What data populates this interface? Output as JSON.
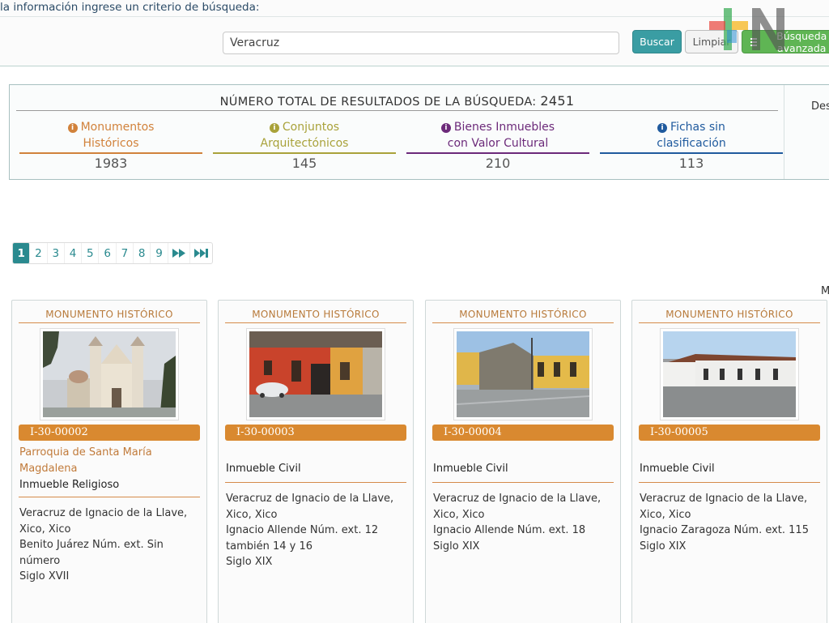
{
  "search": {
    "prompt": "la información ingrese un criterio de búsqueda:",
    "value": "Veracruz",
    "buscar_label": "Buscar",
    "limpiar_label": "Limpiar",
    "avanzada_label": "Búsqueda avanzada"
  },
  "summary": {
    "total_label": "NÚMERO TOTAL DE RESULTADOS DE LA BÚSQUEDA:",
    "total_count": "2451",
    "side_text": "Des",
    "categories": [
      {
        "line1": "Monumentos",
        "line2": "Históricos",
        "count": "1983",
        "color": "#d1823b"
      },
      {
        "line1": "Conjuntos",
        "line2": "Arquitectónicos",
        "count": "145",
        "color": "#a9a23a"
      },
      {
        "line1": "Bienes Inmuebles",
        "line2": "con Valor Cultural",
        "count": "210",
        "color": "#6c2a7a"
      },
      {
        "line1": "Fichas sin",
        "line2": "clasificación",
        "count": "113",
        "color": "#1f5a9e"
      }
    ]
  },
  "pagination": {
    "pages": [
      "1",
      "2",
      "3",
      "4",
      "5",
      "6",
      "7",
      "8",
      "9"
    ],
    "active": "1",
    "next_icon": "fast-forward-icon",
    "last_icon": "skip-to-end-icon"
  },
  "side_letter": "M",
  "cards": [
    {
      "type": "MONUMENTO HISTÓRICO",
      "id": "I-30-00002",
      "name": "Parroquia de Santa María Magdalena",
      "kind": "Inmueble Religioso",
      "lines": [
        "Veracruz de Ignacio de la Llave, Xico, Xico",
        "Benito Juárez Núm. ext. Sin número",
        "Siglo XVII"
      ]
    },
    {
      "type": "MONUMENTO HISTÓRICO",
      "id": "I-30-00003",
      "name": "",
      "kind": "Inmueble Civil",
      "lines": [
        "Veracruz de Ignacio de la Llave, Xico, Xico",
        "Ignacio Allende Núm. ext. 12 también 14 y 16",
        "Siglo XIX"
      ]
    },
    {
      "type": "MONUMENTO HISTÓRICO",
      "id": "I-30-00004",
      "name": "",
      "kind": "Inmueble Civil",
      "lines": [
        "Veracruz de Ignacio de la Llave, Xico, Xico",
        "Ignacio Allende Núm. ext. 18",
        "Siglo XIX"
      ]
    },
    {
      "type": "MONUMENTO HISTÓRICO",
      "id": "I-30-00005",
      "name": "",
      "kind": "Inmueble Civil",
      "lines": [
        "Veracruz de Ignacio de la Llave, Xico, Xico",
        "Ignacio Zaragoza Núm. ext. 115",
        "Siglo XIX"
      ]
    }
  ],
  "colors": {
    "accent_teal": "#2a8a8f",
    "accent_orange": "#d98930",
    "button_green": "#5fb554"
  }
}
